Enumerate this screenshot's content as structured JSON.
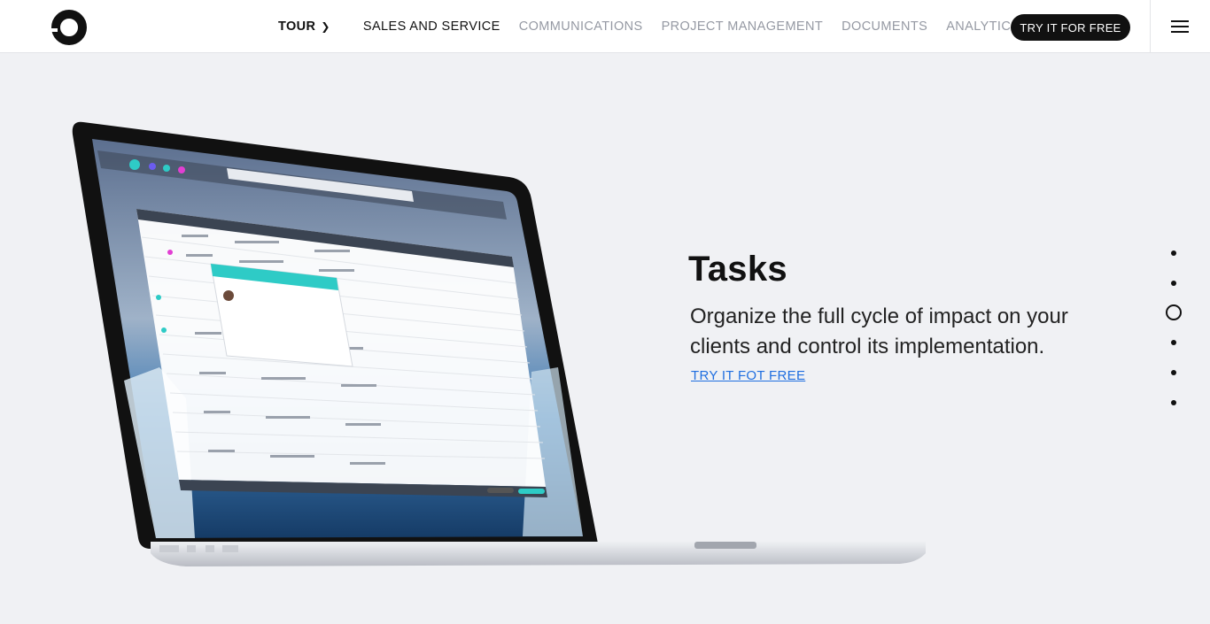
{
  "header": {
    "logo_icon": "ring-logo-icon",
    "nav": {
      "tour": "TOUR",
      "tour_chevron": "❯",
      "sales": "SALES AND SERVICE",
      "communications": "COMMUNICATIONS",
      "project": "PROJECT MANAGEMENT",
      "documents": "DOCUMENTS",
      "analytics": "ANALYTICS"
    },
    "try_button": "TRY IT FOR FREE",
    "menu_icon": "hamburger-menu-icon"
  },
  "main": {
    "title": "Tasks",
    "description": "Organize the full cycle of impact on your clients and control its implementation.",
    "cta_link": "TRY IT FOT FREE"
  },
  "pager": {
    "count": 6,
    "active_index": 2
  },
  "colors": {
    "accent": "#1f6ee0",
    "teal": "#2ecbc6",
    "dark": "#111111",
    "background": "#f0f1f4"
  }
}
